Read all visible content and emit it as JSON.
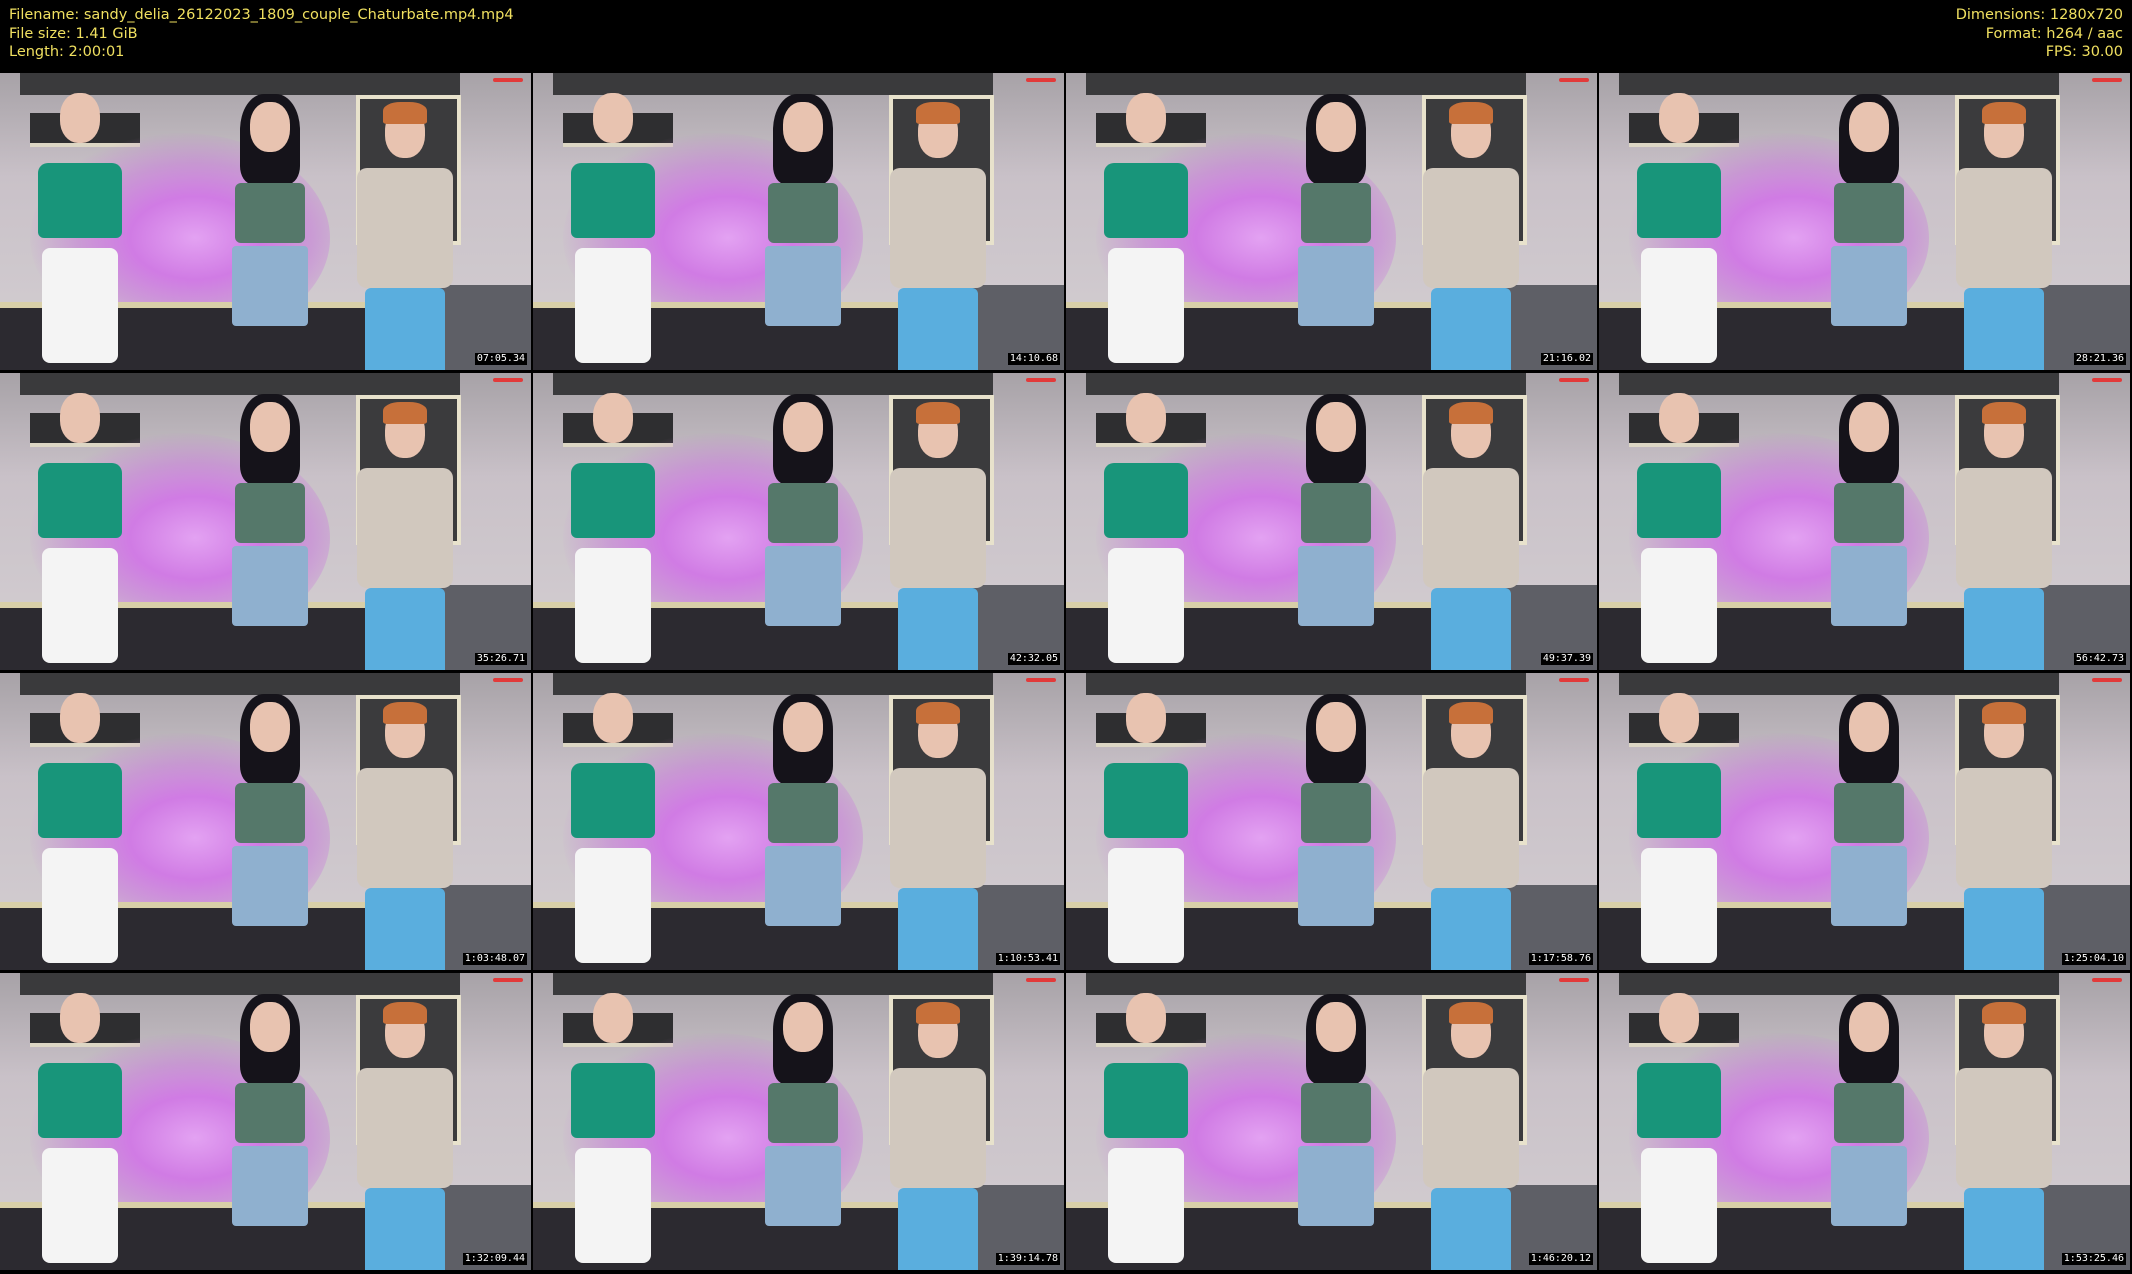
{
  "file_info": {
    "filename_line": "Filename: sandy_delia_26122023_1809_couple_Chaturbate.mp4.mp4",
    "filesize_line": "File size: 1.41 GiB",
    "length_line": "Length: 2:00:01",
    "dimensions_line": "Dimensions: 1280x720",
    "format_line": "Format: h264 / aac",
    "fps_line": "FPS: 30.00"
  },
  "colors": {
    "info_text": "#f0e060",
    "background": "#000000",
    "timestamp_text": "#ffffff"
  },
  "thumbnails": [
    {
      "timestamp": "07:05.34"
    },
    {
      "timestamp": "14:10.68"
    },
    {
      "timestamp": "21:16.02"
    },
    {
      "timestamp": "28:21.36"
    },
    {
      "timestamp": "35:26.71"
    },
    {
      "timestamp": "42:32.05"
    },
    {
      "timestamp": "49:37.39"
    },
    {
      "timestamp": "56:42.73"
    },
    {
      "timestamp": "1:03:48.07"
    },
    {
      "timestamp": "1:10:53.41"
    },
    {
      "timestamp": "1:17:58.76"
    },
    {
      "timestamp": "1:25:04.10"
    },
    {
      "timestamp": "1:32:09.44"
    },
    {
      "timestamp": "1:39:14.78"
    },
    {
      "timestamp": "1:46:20.12"
    },
    {
      "timestamp": "1:53:25.46"
    }
  ]
}
